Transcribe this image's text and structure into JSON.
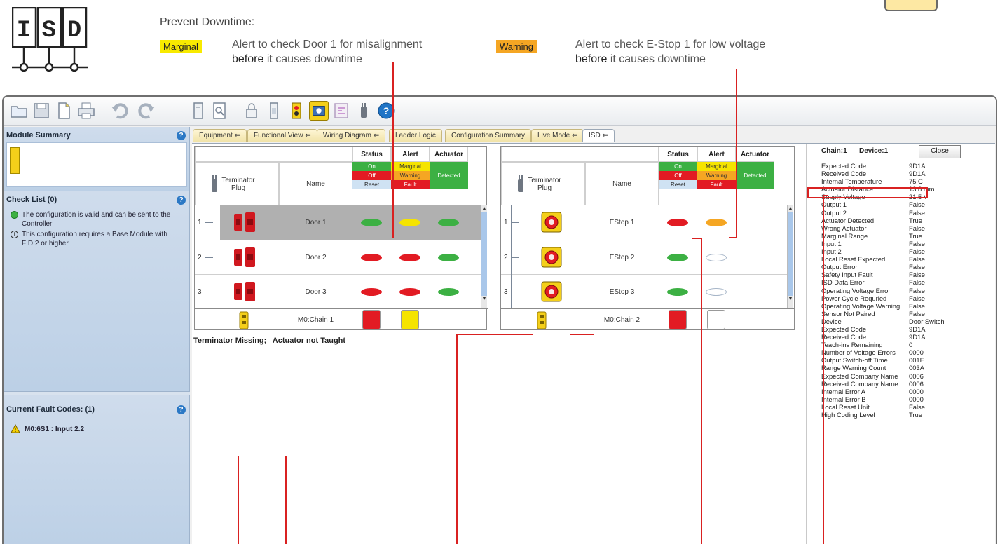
{
  "header": {
    "logo_text": "ISD",
    "prevent_title": "Prevent Downtime:",
    "marginal_badge": "Marginal",
    "marginal_note_1": "Alert to check Door 1 for misalignment ",
    "marginal_note_bold": "before",
    "marginal_note_2": " it causes downtime",
    "warning_badge": "Warning",
    "warning_note_1": "Alert to check E-Stop 1 for low voltage ",
    "warning_note_bold": "before",
    "warning_note_2": " it causes downtime"
  },
  "toolbar": {
    "icons": [
      "open-folder-icon",
      "save-icon",
      "new-document-icon",
      "print-icon",
      "undo-icon",
      "redo-icon",
      "module-icon",
      "zoom-page-icon",
      "lock-icon",
      "device-icon",
      "emergency-stop-icon",
      "isd-active-icon",
      "wiring-icon",
      "plug-icon",
      "help-icon"
    ]
  },
  "module_summary": {
    "title": "Module Summary"
  },
  "check_list": {
    "title": "Check List (0)",
    "items": [
      {
        "icon": "green-dot-icon",
        "text": "The configuration is valid and can be sent to the Controller"
      },
      {
        "icon": "info-icon",
        "text": "This configuration requires a Base Module with FID 2 or higher."
      }
    ]
  },
  "fault_codes": {
    "title": "Current Fault Codes: (1)",
    "items": [
      {
        "icon": "warning-icon",
        "text": "M0:6S1 :  Input 2.2"
      }
    ]
  },
  "tabs": [
    {
      "label": "Equipment",
      "suffix": "⇐",
      "active": false
    },
    {
      "label": "Functional View",
      "suffix": "⇐",
      "active": false
    },
    {
      "label": "Wiring Diagram",
      "suffix": "⇐",
      "active": false
    },
    {
      "label": "Ladder Logic",
      "suffix": "",
      "active": false
    },
    {
      "label": "Configuration Summary",
      "suffix": "",
      "active": false
    },
    {
      "label": "Live Mode",
      "suffix": "⇐",
      "active": false
    },
    {
      "label": "ISD",
      "suffix": "⇐",
      "active": true
    }
  ],
  "grid_headers": {
    "status": "Status",
    "alert": "Alert",
    "actuator": "Actuator",
    "terminator_plug": "Terminator Plug",
    "name": "Name",
    "legend_status": [
      "On",
      "Off",
      "Reset"
    ],
    "legend_alert": [
      "Marginal",
      "Warning",
      "Fault"
    ],
    "legend_actuator": "Detected"
  },
  "colors": {
    "green": "#3cb043",
    "red": "#e21b23",
    "yellow": "#f5e400",
    "orange": "#f5a623",
    "light_blue": "#cfe2f3",
    "callout_red": "#d92121"
  },
  "chain1": {
    "rows": [
      {
        "num": "1",
        "device": "door-switch",
        "name": "Door 1",
        "status": "green",
        "alert": "yellow",
        "actuator": "green",
        "selected": true
      },
      {
        "num": "2",
        "device": "door-switch",
        "name": "Door 2",
        "status": "red",
        "alert": "red",
        "actuator": "green",
        "selected": false
      },
      {
        "num": "3",
        "device": "door-switch",
        "name": "Door 3",
        "status": "red",
        "alert": "red",
        "actuator": "green",
        "selected": false
      }
    ],
    "footer": {
      "name": "M0:Chain 1",
      "status": "red",
      "alert": "yellow"
    }
  },
  "chain2": {
    "rows": [
      {
        "num": "1",
        "device": "estop",
        "name": "EStop 1",
        "status": "red",
        "alert": "orange",
        "actuator": "",
        "selected": false
      },
      {
        "num": "2",
        "device": "estop",
        "name": "EStop 2",
        "status": "green",
        "alert": "white",
        "actuator": "",
        "selected": false
      },
      {
        "num": "3",
        "device": "estop",
        "name": "EStop 3",
        "status": "green",
        "alert": "white",
        "actuator": "",
        "selected": false
      }
    ],
    "footer": {
      "name": "M0:Chain 2",
      "status": "red",
      "alert": "white"
    }
  },
  "terminator_message": {
    "label": "Terminator Missing;",
    "value": "Actuator not Taught"
  },
  "properties": {
    "chain_label": "Chain:1",
    "device_label": "Device:1",
    "close_button": "Close",
    "rows": [
      [
        "Expected Code",
        "9D1A"
      ],
      [
        "Received Code",
        "9D1A"
      ],
      [
        "Internal Temperature",
        "75 C"
      ],
      [
        "Actuator Distance",
        "13.8 mm"
      ],
      [
        "Supply Voltage",
        "21.5 V"
      ],
      [
        "Output 1",
        "False"
      ],
      [
        "Output 2",
        "False"
      ],
      [
        "Actuator Detected",
        "True"
      ],
      [
        "Wrong Actuator",
        "False"
      ],
      [
        "Marginal Range",
        "True"
      ],
      [
        "Input 1",
        "False"
      ],
      [
        "Input 2",
        "False"
      ],
      [
        "Local Reset Expected",
        "False"
      ],
      [
        "Output Error",
        "False"
      ],
      [
        "Safety Input Fault",
        "False"
      ],
      [
        "ISD Data Error",
        "False"
      ],
      [
        "Operating Voltage Error",
        "False"
      ],
      [
        "Power Cycle Requried",
        "False"
      ],
      [
        "Operating Voltage Warning",
        "False"
      ],
      [
        "Sensor Not Paired",
        "False"
      ],
      [
        "Device",
        "Door Switch"
      ],
      [
        "Expected Code",
        "9D1A"
      ],
      [
        "Received Code",
        "9D1A"
      ],
      [
        "Teach-ins Remaining",
        "0"
      ],
      [
        "Number of Voltage Errors",
        "0000"
      ],
      [
        "Output Switch-off Time",
        "001F"
      ],
      [
        "Range Warning Count",
        "003A"
      ],
      [
        "Expected Company Name",
        "0006"
      ],
      [
        "Received Company Name",
        "0006"
      ],
      [
        "Internal Error A",
        "0000"
      ],
      [
        "Internal Error B",
        "0000"
      ],
      [
        "Local Reset Unit",
        "False"
      ],
      [
        "High Coding Level",
        "True"
      ]
    ]
  }
}
